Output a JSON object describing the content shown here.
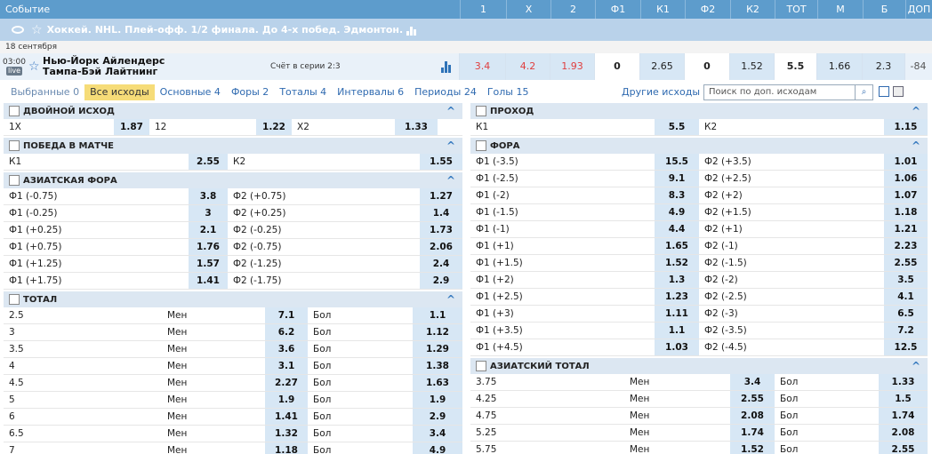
{
  "header": {
    "event": "Событие",
    "cols": [
      "1",
      "X",
      "2",
      "Ф1",
      "К1",
      "Ф2",
      "К2",
      "ТОТ",
      "М",
      "Б",
      "ДОП"
    ]
  },
  "league": {
    "title": "Хоккей. NHL. Плей-офф. 1/2 финала. До 4-х побед. Эдмонтон."
  },
  "date": "18 сентября",
  "event": {
    "time": "03:00",
    "live": "live",
    "team1": "Нью-Йорк Айлендерс",
    "team2": "Тампа-Бэй Лайтнинг",
    "score": "Счёт в серии 2:3",
    "odds": [
      "3.4",
      "4.2",
      "1.93",
      "0",
      "2.65",
      "0",
      "1.52",
      "5.5",
      "1.66",
      "2.3",
      "-84"
    ]
  },
  "tabs": {
    "items": [
      "Выбранные 0",
      "Все исходы",
      "Основные 4",
      "Форы 2",
      "Тоталы 4",
      "Интервалы 6",
      "Периоды 24",
      "Голы 15"
    ],
    "other": "Другие исходы",
    "search_placeholder": "Поиск по доп. исходам",
    "search_icon": "search-icon"
  },
  "left": {
    "double": {
      "title": "ДВОЙНОЙ ИСХОД",
      "row": [
        "1X",
        "1.87",
        "12",
        "1.22",
        "X2",
        "1.33"
      ]
    },
    "win": {
      "title": "ПОБЕДА В МАТЧЕ",
      "row": [
        "К1",
        "2.55",
        "К2",
        "1.55"
      ]
    },
    "asian": {
      "title": "АЗИАТСКАЯ ФОРА",
      "rows": [
        [
          "Ф1 (-0.75)",
          "3.8",
          "Ф2 (+0.75)",
          "1.27"
        ],
        [
          "Ф1 (-0.25)",
          "3",
          "Ф2 (+0.25)",
          "1.4"
        ],
        [
          "Ф1 (+0.25)",
          "2.1",
          "Ф2 (-0.25)",
          "1.73"
        ],
        [
          "Ф1 (+0.75)",
          "1.76",
          "Ф2 (-0.75)",
          "2.06"
        ],
        [
          "Ф1 (+1.25)",
          "1.57",
          "Ф2 (-1.25)",
          "2.4"
        ],
        [
          "Ф1 (+1.75)",
          "1.41",
          "Ф2 (-1.75)",
          "2.9"
        ]
      ]
    },
    "total": {
      "title": "ТОТАЛ",
      "less": "Мен",
      "more": "Бол",
      "rows": [
        [
          "2.5",
          "7.1",
          "1.1"
        ],
        [
          "3",
          "6.2",
          "1.12"
        ],
        [
          "3.5",
          "3.6",
          "1.29"
        ],
        [
          "4",
          "3.1",
          "1.38"
        ],
        [
          "4.5",
          "2.27",
          "1.63"
        ],
        [
          "5",
          "1.9",
          "1.9"
        ],
        [
          "6",
          "1.41",
          "2.9"
        ],
        [
          "6.5",
          "1.32",
          "3.4"
        ],
        [
          "7",
          "1.18",
          "4.9"
        ]
      ]
    }
  },
  "right": {
    "pass": {
      "title": "ПРОХОД",
      "row": [
        "К1",
        "5.5",
        "К2",
        "1.15"
      ]
    },
    "fora": {
      "title": "ФОРА",
      "rows": [
        [
          "Ф1 (-3.5)",
          "15.5",
          "Ф2 (+3.5)",
          "1.01"
        ],
        [
          "Ф1 (-2.5)",
          "9.1",
          "Ф2 (+2.5)",
          "1.06"
        ],
        [
          "Ф1 (-2)",
          "8.3",
          "Ф2 (+2)",
          "1.07"
        ],
        [
          "Ф1 (-1.5)",
          "4.9",
          "Ф2 (+1.5)",
          "1.18"
        ],
        [
          "Ф1 (-1)",
          "4.4",
          "Ф2 (+1)",
          "1.21"
        ],
        [
          "Ф1 (+1)",
          "1.65",
          "Ф2 (-1)",
          "2.23"
        ],
        [
          "Ф1 (+1.5)",
          "1.52",
          "Ф2 (-1.5)",
          "2.55"
        ],
        [
          "Ф1 (+2)",
          "1.3",
          "Ф2 (-2)",
          "3.5"
        ],
        [
          "Ф1 (+2.5)",
          "1.23",
          "Ф2 (-2.5)",
          "4.1"
        ],
        [
          "Ф1 (+3)",
          "1.11",
          "Ф2 (-3)",
          "6.5"
        ],
        [
          "Ф1 (+3.5)",
          "1.1",
          "Ф2 (-3.5)",
          "7.2"
        ],
        [
          "Ф1 (+4.5)",
          "1.03",
          "Ф2 (-4.5)",
          "12.5"
        ]
      ]
    },
    "asian_total": {
      "title": "АЗИАТСКИЙ ТОТАЛ",
      "less": "Мен",
      "more": "Бол",
      "rows": [
        [
          "3.75",
          "3.4",
          "1.33"
        ],
        [
          "4.25",
          "2.55",
          "1.5"
        ],
        [
          "4.75",
          "2.08",
          "1.74"
        ],
        [
          "5.25",
          "1.74",
          "2.08"
        ],
        [
          "5.75",
          "1.52",
          "2.55"
        ]
      ]
    }
  }
}
